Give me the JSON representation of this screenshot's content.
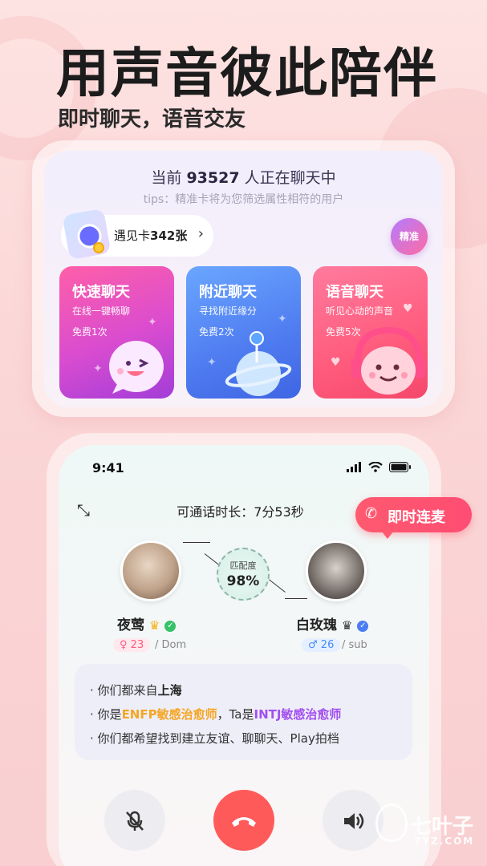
{
  "hero": {
    "headline": "用声音彼此陪伴",
    "subline": "即时聊天，语音交友"
  },
  "panel": {
    "online_prefix": "当前",
    "online_count": "93527",
    "online_suffix": "人正在聊天中",
    "tips": "tips：精准卡将为您筛选属性相符的用户",
    "meet_card_label": "遇见卡",
    "meet_card_count": "342张",
    "precise_badge": "精准",
    "tiles": [
      {
        "title": "快速聊天",
        "desc": "在线一键畅聊",
        "free": "免费1次"
      },
      {
        "title": "附近聊天",
        "desc": "寻找附近缘分",
        "free": "免费2次"
      },
      {
        "title": "语音聊天",
        "desc": "听见心动的声音",
        "free": "免费5次"
      }
    ]
  },
  "call": {
    "status_time": "9:41",
    "duration_label": "可通话时长：7分53秒",
    "instant_mic": "即时连麦",
    "match_label": "匹配度",
    "match_value": "98%",
    "left_user": {
      "name": "夜莺",
      "age": "23",
      "role": "Dom",
      "gender": "female"
    },
    "right_user": {
      "name": "白玫瑰",
      "age": "26",
      "role": "sub",
      "gender": "male"
    },
    "info": {
      "line1_prefix": "你们都来自",
      "line1_city": "上海",
      "line2_prefix": "你是",
      "line2_type1": "ENFP敏感治愈师",
      "line2_mid": "，Ta是",
      "line2_type2": "INTJ敏感治愈师",
      "line3": "你们都希望找到建立友谊、聊聊天、Play拍档"
    },
    "controls": [
      "mute-icon",
      "hangup-icon",
      "speaker-icon"
    ]
  },
  "watermark": {
    "main": "七叶子",
    "sub": "7YZ.COM"
  },
  "colors": {
    "tile_pink": "#d94cd0",
    "tile_blue": "#4f7cf0",
    "tile_red": "#ff5c7d",
    "hangup": "#ff5a5a",
    "accent_yellow": "#f5a623",
    "accent_purple": "#a24ff0"
  }
}
